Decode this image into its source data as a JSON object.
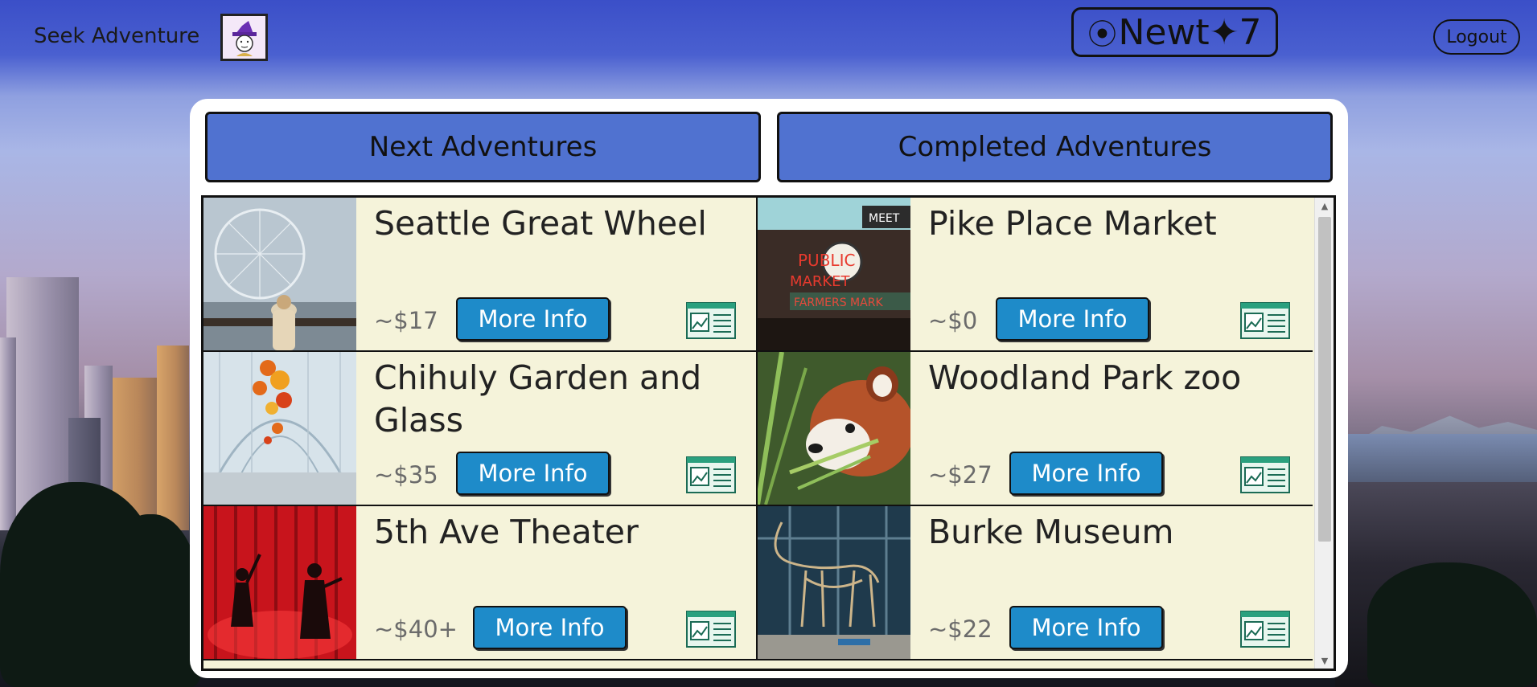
{
  "header": {
    "brand": "Seek Adventure",
    "logo_symbol": "⦿",
    "logo_text": "Newt✦7",
    "logout_label": "Logout"
  },
  "tabs": {
    "next": "Next Adventures",
    "completed": "Completed Adventures"
  },
  "adventures": [
    {
      "title": "Seattle Great Wheel",
      "price": "~$17",
      "more": "More Info"
    },
    {
      "title": "Pike Place Market",
      "price": "~$0",
      "more": "More Info"
    },
    {
      "title": "Chihuly Garden and Glass",
      "price": "~$35",
      "more": "More Info"
    },
    {
      "title": "Woodland Park zoo",
      "price": "~$27",
      "more": "More Info"
    },
    {
      "title": "5th Ave Theater",
      "price": "~$40+",
      "more": "More Info"
    },
    {
      "title": "Burke Museum",
      "price": "~$22",
      "more": "More Info"
    }
  ],
  "icons": {
    "avatar": "wizard-avatar-icon",
    "news": "news-article-icon"
  },
  "colors": {
    "tab_bg": "#5072d0",
    "card_bg": "#f5f3da",
    "button_bg": "#1e8bc9"
  }
}
